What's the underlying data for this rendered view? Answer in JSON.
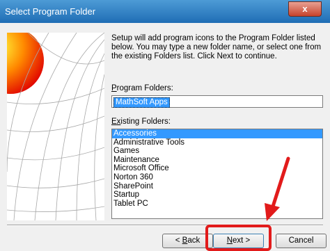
{
  "window": {
    "title": "Select Program Folder",
    "close_glyph": "x"
  },
  "description": "Setup will add program icons to the Program Folder listed below. You may type a new folder name, or select one from the existing Folders list.  Click Next to continue.",
  "program_folders": {
    "label_prefix": "",
    "label_accel": "P",
    "label_rest": "rogram Folders:",
    "value": "MathSoft Apps"
  },
  "existing_folders": {
    "label_prefix": "E",
    "label_accel": "x",
    "label_rest": "isting Folders:",
    "items": [
      "Accessories",
      "Administrative Tools",
      "Games",
      "Maintenance",
      "Microsoft Office",
      "Norton 360",
      "SharePoint",
      "Startup",
      "Tablet PC"
    ],
    "selected_index": 0
  },
  "buttons": {
    "back_prefix": "< ",
    "back_accel": "B",
    "back_rest": "ack",
    "next_accel": "N",
    "next_rest": "ext >",
    "cancel": "Cancel"
  },
  "colors": {
    "titlebar": "#2a78c0",
    "selection": "#3399ff",
    "annotation": "#e21b1b"
  }
}
